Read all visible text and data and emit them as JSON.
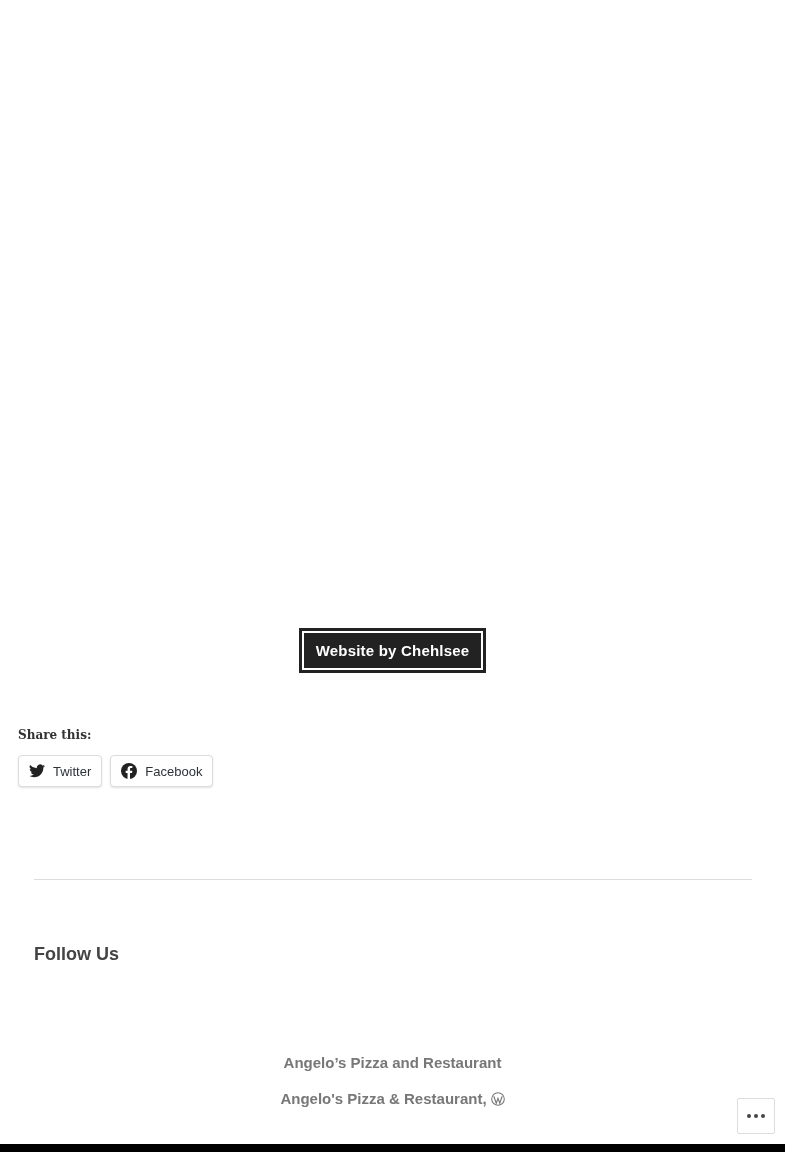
{
  "credit_button": {
    "label": "Website by Chehlsee"
  },
  "share": {
    "heading": "Share this:",
    "buttons": [
      {
        "kind": "twitter",
        "label": "Twitter"
      },
      {
        "kind": "facebook",
        "label": "Facebook"
      }
    ]
  },
  "widget": {
    "title": "Follow Us"
  },
  "footer": {
    "site_title": "Angelo’s Pizza and Restaurant",
    "credit": "Angelo's Pizza & Restaurant,"
  }
}
